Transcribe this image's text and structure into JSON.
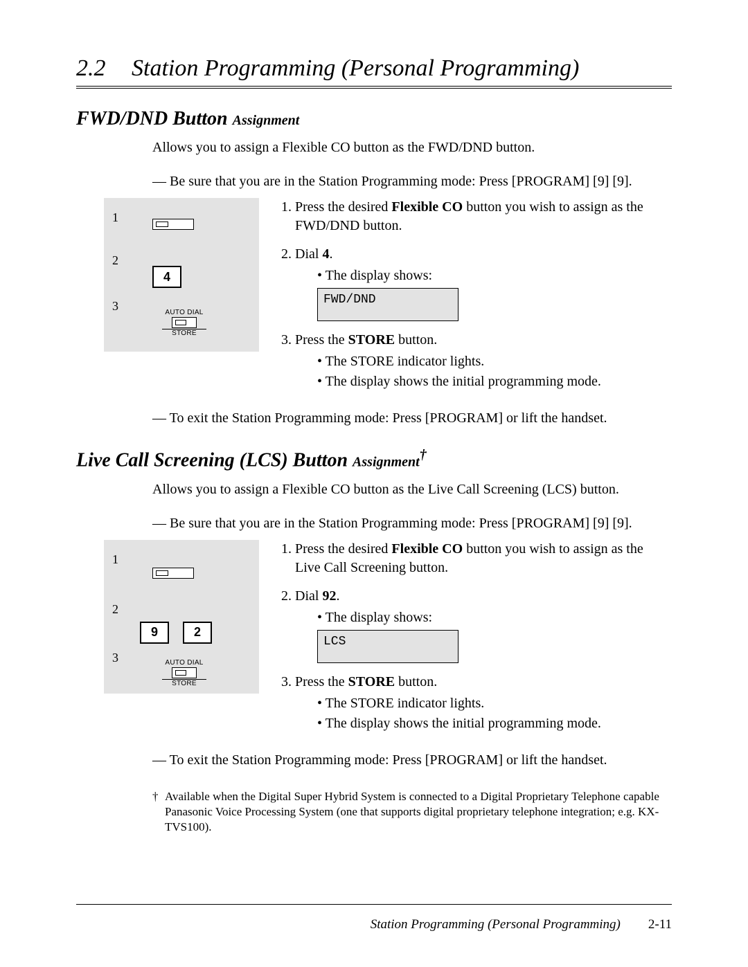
{
  "header": {
    "num": "2.2",
    "title": "Station Programming (Personal Programming)"
  },
  "sec1": {
    "heading_main": "FWD/DND Button",
    "heading_small": "Assignment",
    "intro": "Allows you to assign a Flexible CO button as the FWD/DND button.",
    "pre": "— Be sure that you are in the Station Programming mode: Press [PROGRAM] [9] [9].",
    "keys": [
      "4"
    ],
    "auto_dial": "AUTO DIAL",
    "store_label": "STORE",
    "step1_a": "Press the desired ",
    "step1_b": "Flexible CO",
    "step1_c": " button you wish to assign as the FWD/DND button.",
    "step2_a": "Dial ",
    "dial": "4",
    "step2_b": ".",
    "bullet_display": "The display shows:",
    "display": "FWD/DND",
    "step3_a": "Press the ",
    "step3_b": "STORE",
    "step3_c": " button.",
    "bullet_store1": "The STORE indicator lights.",
    "bullet_store2": "The display shows the initial programming mode.",
    "exit": "— To exit the Station Programming mode: Press [PROGRAM] or lift the handset."
  },
  "sec2": {
    "heading_main": "Live Call Screening (LCS) Button",
    "heading_small": "Assignment",
    "dagger": "†",
    "intro": "Allows you to assign a Flexible CO button as the Live Call Screening (LCS) button.",
    "pre": "— Be sure that you are in the Station Programming mode: Press [PROGRAM] [9] [9].",
    "keys": [
      "9",
      "2"
    ],
    "auto_dial": "AUTO DIAL",
    "store_label": "STORE",
    "step1_a": "Press the desired ",
    "step1_b": "Flexible CO",
    "step1_c": " button you wish to assign as the Live Call Screening button.",
    "step2_a": "Dial ",
    "dial": "92",
    "step2_b": ".",
    "bullet_display": "The display shows:",
    "display": "LCS",
    "step3_a": "Press the ",
    "step3_b": "STORE",
    "step3_c": " button.",
    "bullet_store1": "The STORE indicator lights.",
    "bullet_store2": "The display shows the initial programming mode.",
    "exit": "— To exit the Station Programming mode: Press [PROGRAM] or lift the handset."
  },
  "footnote": {
    "dagger": "†",
    "text": "Available when the Digital Super Hybrid System is connected to a Digital Proprietary Telephone capable Panasonic Voice Processing System (one that supports digital proprietary telephone integration; e.g. KX-TVS100)."
  },
  "footer": {
    "title": "Station Programming (Personal Programming)",
    "page": "2-11"
  },
  "labels": {
    "n1": "1",
    "n2": "2",
    "n3": "3"
  }
}
